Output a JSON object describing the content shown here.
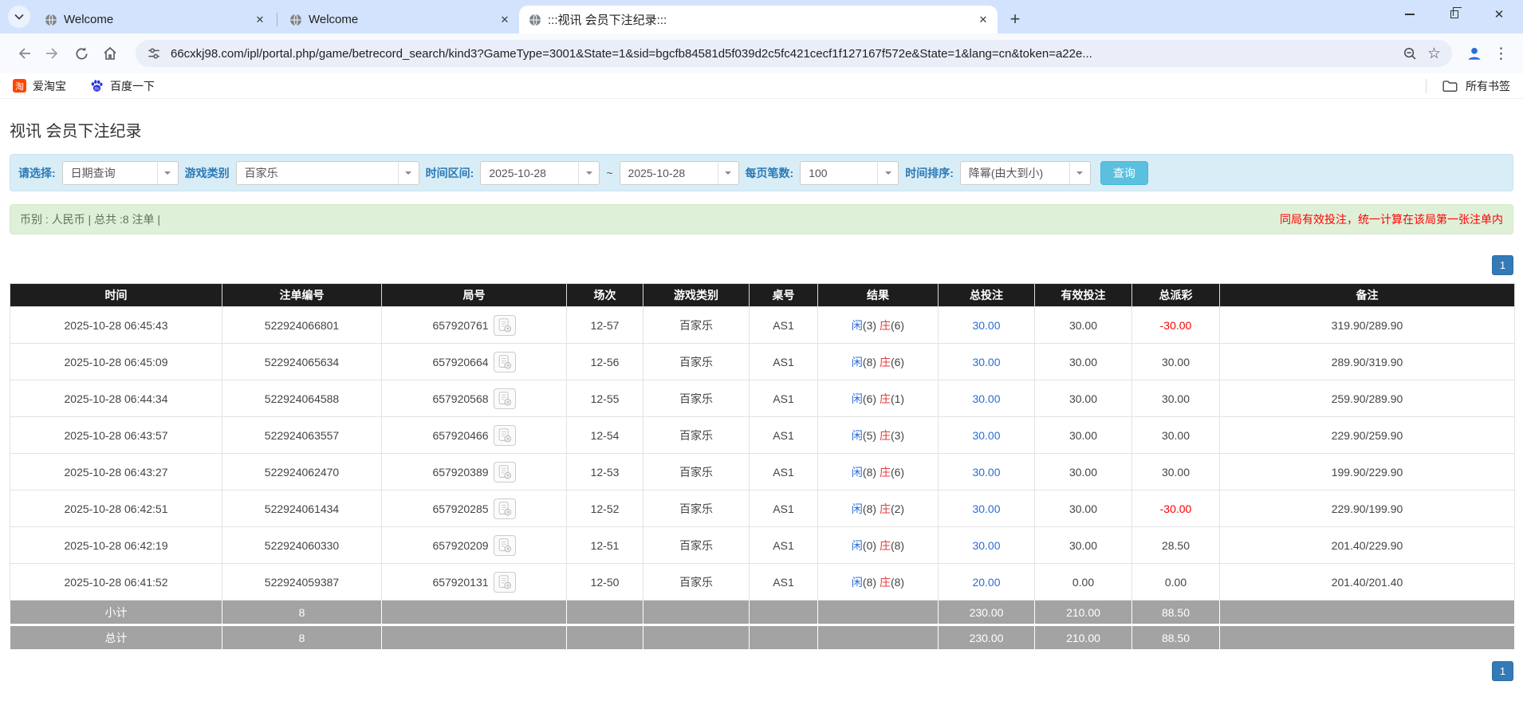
{
  "browser": {
    "tabs": [
      {
        "title": "Welcome"
      },
      {
        "title": "Welcome"
      },
      {
        "title": ":::视讯 会员下注纪录:::"
      }
    ],
    "url": "66cxkj98.com/ipl/portal.php/game/betrecord_search/kind3?GameType=3001&State=1&sid=bgcfb84581d5f039d2c5fc421cecf1f127167f572e&State=1&lang=cn&token=a22e...",
    "bookmarks": [
      {
        "label": "爱淘宝",
        "icon": "taobao-icon"
      },
      {
        "label": "百度一下",
        "icon": "baidu-icon"
      }
    ],
    "all_bookmarks_label": "所有书签"
  },
  "page": {
    "title": "视讯 会员下注纪录",
    "filters": {
      "select_label": "请选择:",
      "select_value": "日期查询",
      "game_type_label": "游戏类别",
      "game_type_value": "百家乐",
      "date_range_label": "时间区间:",
      "date_from": "2025-10-28",
      "date_separator": "~",
      "date_to": "2025-10-28",
      "per_page_label": "每页笔数:",
      "per_page_value": "100",
      "sort_label": "时间排序:",
      "sort_value": "降幂(由大到小)",
      "search_button": "查询"
    },
    "info_bar": {
      "left": "币别 : 人民币 | 总共 :8 注单 |",
      "right": "同局有效投注，统一计算在该局第一张注单内"
    },
    "pagination": "1",
    "table": {
      "headers": [
        "时间",
        "注单编号",
        "局号",
        "场次",
        "游戏类别",
        "桌号",
        "结果",
        "总投注",
        "有效投注",
        "总派彩",
        "备注"
      ],
      "rows": [
        {
          "time": "2025-10-28 06:45:43",
          "bet_no": "522924066801",
          "round_no": "657920761",
          "session": "12-57",
          "game": "百家乐",
          "table_no": "AS1",
          "player": "闲(3)",
          "banker": "庄(6)",
          "total_bet": "30.00",
          "valid_bet": "30.00",
          "payout": "-30.00",
          "remark": "319.90/289.90"
        },
        {
          "time": "2025-10-28 06:45:09",
          "bet_no": "522924065634",
          "round_no": "657920664",
          "session": "12-56",
          "game": "百家乐",
          "table_no": "AS1",
          "player": "闲(8)",
          "banker": "庄(6)",
          "total_bet": "30.00",
          "valid_bet": "30.00",
          "payout": "30.00",
          "remark": "289.90/319.90"
        },
        {
          "time": "2025-10-28 06:44:34",
          "bet_no": "522924064588",
          "round_no": "657920568",
          "session": "12-55",
          "game": "百家乐",
          "table_no": "AS1",
          "player": "闲(6)",
          "banker": "庄(1)",
          "total_bet": "30.00",
          "valid_bet": "30.00",
          "payout": "30.00",
          "remark": "259.90/289.90"
        },
        {
          "time": "2025-10-28 06:43:57",
          "bet_no": "522924063557",
          "round_no": "657920466",
          "session": "12-54",
          "game": "百家乐",
          "table_no": "AS1",
          "player": "闲(5)",
          "banker": "庄(3)",
          "total_bet": "30.00",
          "valid_bet": "30.00",
          "payout": "30.00",
          "remark": "229.90/259.90"
        },
        {
          "time": "2025-10-28 06:43:27",
          "bet_no": "522924062470",
          "round_no": "657920389",
          "session": "12-53",
          "game": "百家乐",
          "table_no": "AS1",
          "player": "闲(8)",
          "banker": "庄(6)",
          "total_bet": "30.00",
          "valid_bet": "30.00",
          "payout": "30.00",
          "remark": "199.90/229.90"
        },
        {
          "time": "2025-10-28 06:42:51",
          "bet_no": "522924061434",
          "round_no": "657920285",
          "session": "12-52",
          "game": "百家乐",
          "table_no": "AS1",
          "player": "闲(8)",
          "banker": "庄(2)",
          "total_bet": "30.00",
          "valid_bet": "30.00",
          "payout": "-30.00",
          "remark": "229.90/199.90"
        },
        {
          "time": "2025-10-28 06:42:19",
          "bet_no": "522924060330",
          "round_no": "657920209",
          "session": "12-51",
          "game": "百家乐",
          "table_no": "AS1",
          "player": "闲(0)",
          "banker": "庄(8)",
          "total_bet": "30.00",
          "valid_bet": "30.00",
          "payout": "28.50",
          "remark": "201.40/229.90"
        },
        {
          "time": "2025-10-28 06:41:52",
          "bet_no": "522924059387",
          "round_no": "657920131",
          "session": "12-50",
          "game": "百家乐",
          "table_no": "AS1",
          "player": "闲(8)",
          "banker": "庄(8)",
          "total_bet": "20.00",
          "valid_bet": "0.00",
          "payout": "0.00",
          "remark": "201.40/201.40"
        }
      ],
      "subtotal": {
        "label": "小计",
        "count": "8",
        "total_bet": "230.00",
        "valid_bet": "210.00",
        "payout": "88.50"
      },
      "total": {
        "label": "总计",
        "count": "8",
        "total_bet": "230.00",
        "valid_bet": "210.00",
        "payout": "88.50"
      }
    }
  }
}
